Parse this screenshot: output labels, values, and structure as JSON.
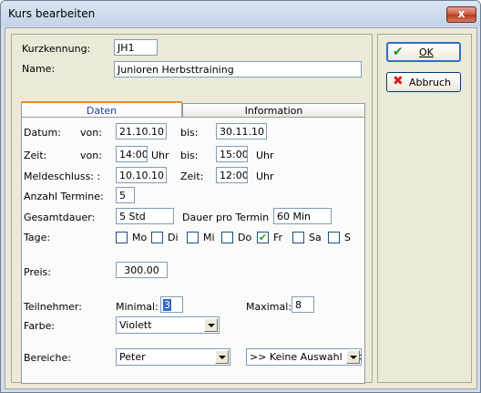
{
  "window": {
    "title": "Kurs bearbeiten",
    "close_glyph": "x"
  },
  "header": {
    "kurzkennung_label": "Kurzkennung:",
    "kurzkennung_value": "JH1",
    "name_label": "Name:",
    "name_value": "Junioren Herbsttraining"
  },
  "tabs": [
    {
      "label": "Daten",
      "active": true
    },
    {
      "label": "Information",
      "active": false
    }
  ],
  "daten": {
    "datum_label": "Datum:",
    "von_label": "von:",
    "datum_von": "21.10.10",
    "bis_label": "bis:",
    "datum_bis": "30.11.10",
    "zeit_label": "Zeit:",
    "zeit_von_label": "von:",
    "zeit_von": "14:00",
    "uhr1": "Uhr",
    "zeit_bis_label": "bis:",
    "zeit_bis": "15:00",
    "uhr2": "Uhr",
    "meldeschluss_label": "Meldeschluss: :",
    "meldeschluss": "10.10.10",
    "meld_zeit_label": "Zeit:",
    "meld_zeit": "12:00",
    "uhr3": "Uhr",
    "anzahl_label": "Anzahl Termine:",
    "anzahl": "5",
    "gesamtdauer_label": "Gesamtdauer:",
    "gesamtdauer": "5 Std",
    "dauer_label": "Dauer pro Termin",
    "dauer": "60 Min",
    "tage_label": "Tage:",
    "tage": [
      {
        "label": "Mo",
        "checked": false
      },
      {
        "label": "Di",
        "checked": false
      },
      {
        "label": "Mi",
        "checked": false
      },
      {
        "label": "Do",
        "checked": false
      },
      {
        "label": "Fr",
        "checked": true
      },
      {
        "label": "Sa",
        "checked": false
      },
      {
        "label": "S·",
        "checked": false
      }
    ],
    "preis_label": "Preis:",
    "preis": "300.00",
    "teilnehmer_label": "Teilnehmer:",
    "minimal_label": "Minimal:",
    "minimal": "3",
    "maximal_label": "Maximal:",
    "maximal": "8",
    "farbe_label": "Farbe:",
    "farbe": "Violett",
    "bereiche_label": "Bereiche:",
    "bereich1": "Peter",
    "bereich2": ">> Keine Auswahl <<"
  },
  "buttons": {
    "ok": "OK",
    "abbruch": "Abbruch"
  },
  "colors": {
    "selection": "#3169c6",
    "ok_check": "#2e8b2e",
    "cancel_x": "#d42020",
    "tab_text": "#1f3f9f"
  }
}
